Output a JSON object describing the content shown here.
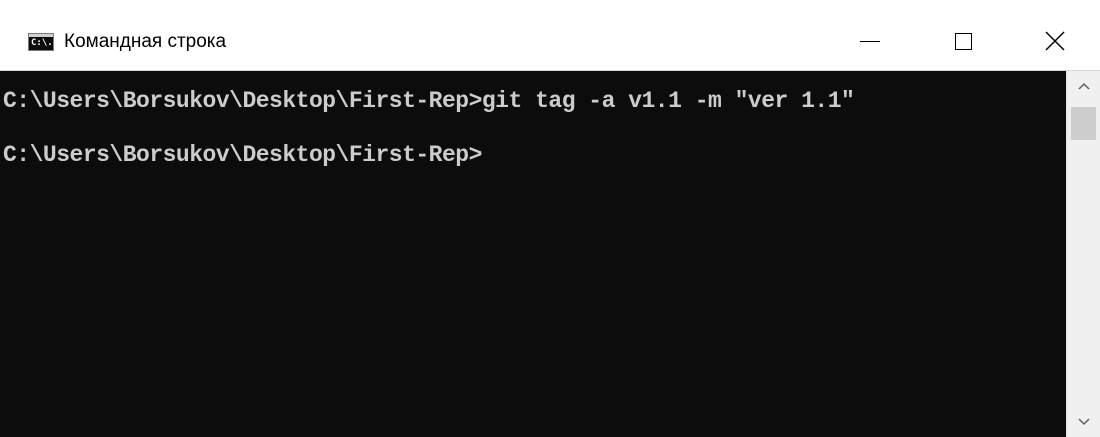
{
  "window": {
    "title": "Командная строка",
    "icon": "cmd-icon",
    "icon_text": "C:\\.",
    "controls": {
      "minimize": "minimize-icon",
      "maximize": "maximize-icon",
      "close": "close-icon"
    }
  },
  "console": {
    "background": "#0c0c0c",
    "foreground": "#cccccc",
    "lines": [
      "C:\\Users\\Borsukov\\Desktop\\First-Rep>git tag -a v1.1 -m \"ver 1.1\"",
      "C:\\Users\\Borsukov\\Desktop\\First-Rep>"
    ]
  },
  "scrollbar": {
    "up": "chevron-up-icon",
    "down": "chevron-down-icon"
  }
}
